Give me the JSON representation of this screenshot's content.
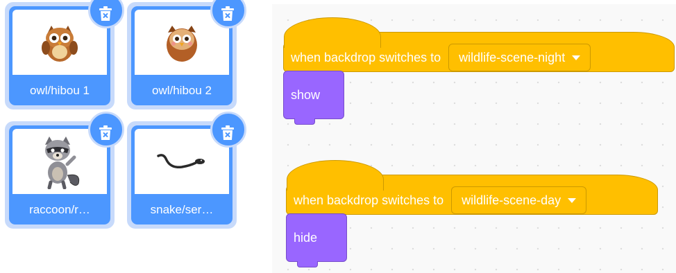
{
  "sprites": [
    {
      "label": "owl/hibou 1",
      "icon": "owl-icon",
      "delete_icon": "trash-icon"
    },
    {
      "label": "owl/hibou 2",
      "icon": "owl-icon",
      "delete_icon": "trash-icon"
    },
    {
      "label": "raccoon/r…",
      "icon": "raccoon-icon",
      "delete_icon": "trash-icon"
    },
    {
      "label": "snake/ser…",
      "icon": "snake-icon",
      "delete_icon": "trash-icon"
    }
  ],
  "scripts": [
    {
      "hat_text": "when backdrop switches to",
      "backdrop": "wildlife-scene-night",
      "action": "show"
    },
    {
      "hat_text": "when backdrop switches to",
      "backdrop": "wildlife-scene-day",
      "action": "hide"
    }
  ],
  "colors": {
    "tile_selected": "#4c97ff",
    "tile_outline": "#c7dafb",
    "events": "#ffbf00",
    "looks": "#9966ff"
  }
}
